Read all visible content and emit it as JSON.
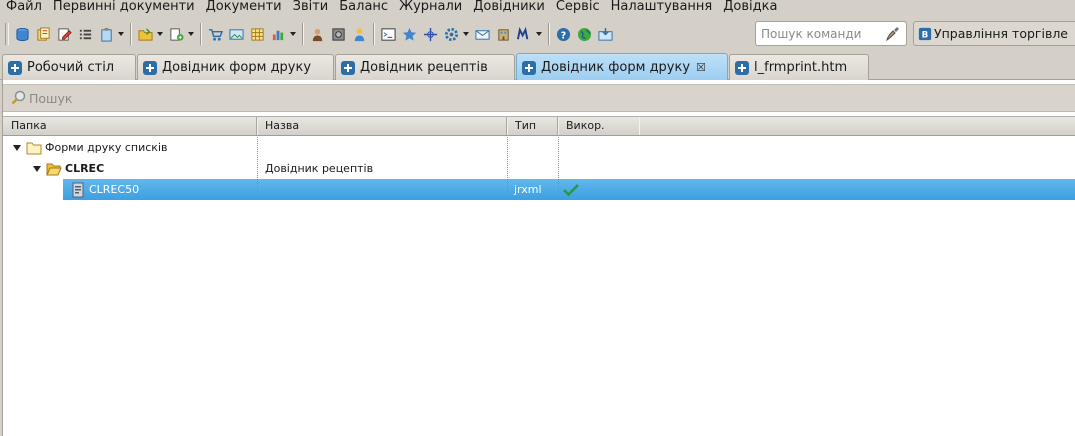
{
  "menubar": {
    "items": [
      "Файл",
      "Первинні документи",
      "Документи",
      "Звіти",
      "Баланс",
      "Журнали",
      "Довідники",
      "Сервіс",
      "Налаштування",
      "Довідка"
    ]
  },
  "toolbar": {
    "buttons": [
      "database-icon",
      "documents-icon",
      "edit-document-icon",
      "list-icon",
      "clipboard-dropdown",
      "open-folder-dropdown",
      "new-document-dropdown",
      "cart-icon",
      "picture-icon",
      "grid-icon",
      "chart-dropdown",
      "user-icon",
      "safe-icon",
      "person-icon",
      "console-icon",
      "star-icon",
      "crosshair-icon",
      "settings-dropdown",
      "mail-icon",
      "building-icon",
      "macro-dropdown",
      "help-icon",
      "globe-icon",
      "inbox-icon"
    ],
    "command_search": {
      "placeholder": "Пошук команди",
      "value": ""
    },
    "perspective_label": "Управління торгівле"
  },
  "tabs": [
    {
      "label": "Робочий стіл",
      "active": false
    },
    {
      "label": "Довідник форм друку",
      "active": false
    },
    {
      "label": "Довідник рецептів",
      "active": false
    },
    {
      "label": "Довідник форм друку",
      "active": true,
      "closable": true,
      "close_glyph": "☒"
    },
    {
      "label": "l_frmprint.htm",
      "active": false
    }
  ],
  "editor": {
    "search_label": "Пошук",
    "columns": [
      "Папка",
      "Назва",
      "Тип",
      "Викор."
    ],
    "rows": [
      {
        "folder": "Форми друку списків",
        "name": "",
        "type": "",
        "used": ""
      },
      {
        "folder": "CLREC",
        "name": "Довідник рецептів",
        "type": "",
        "used": ""
      },
      {
        "folder": "CLREC50",
        "name": "",
        "type": "jrxml",
        "used": "check-icon"
      }
    ]
  },
  "colors": {
    "selection": "#4aa8e6",
    "active_tab": "#a8d4f2",
    "background": "#d4d0c8"
  }
}
